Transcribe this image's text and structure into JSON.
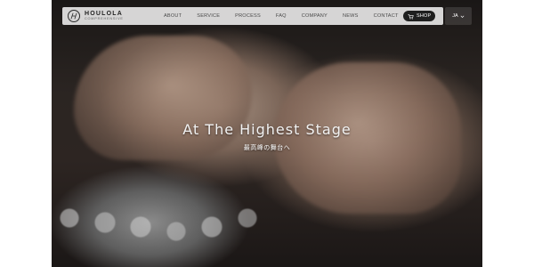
{
  "brand": {
    "name": "HOULOLA",
    "subtitle": "COMPREHENSIVE"
  },
  "nav": {
    "items": [
      "ABOUT",
      "SERVICE",
      "PROCESS",
      "FAQ",
      "COMPANY",
      "NEWS",
      "CONTACT"
    ],
    "shop_label": "SHOP",
    "language": "JA"
  },
  "hero": {
    "title": "At The Highest Stage",
    "subtitle": "最高峰の舞台へ"
  }
}
